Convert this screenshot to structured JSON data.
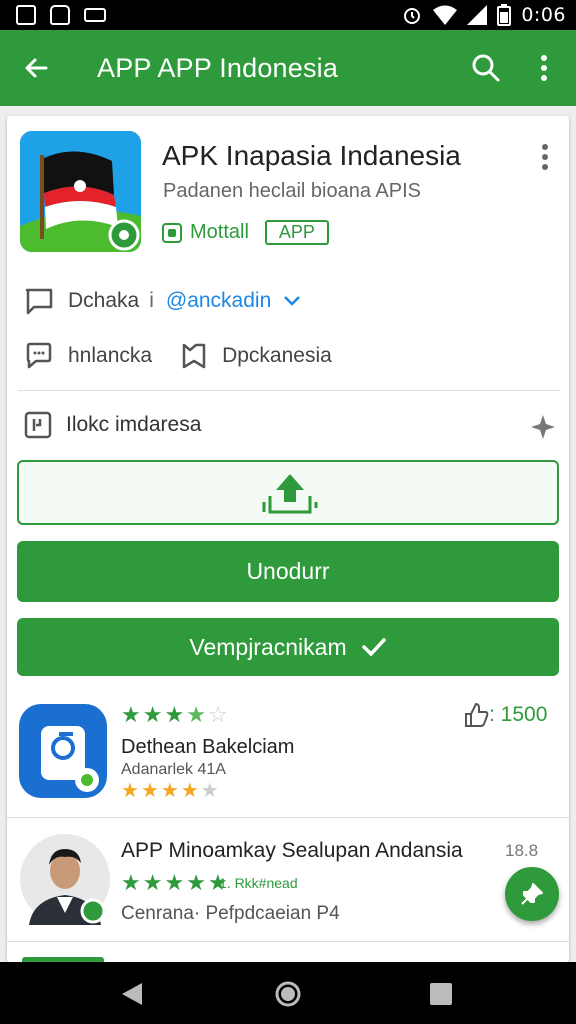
{
  "status_bar": {
    "time": "0:06",
    "icons": [
      "notification-icon",
      "android-icon",
      "screen-icon",
      "alarm-icon",
      "wifi-icon",
      "signal-icon",
      "battery-icon"
    ]
  },
  "app_bar": {
    "title": "APP  APP Indonesia",
    "icons": [
      "back-arrow-icon",
      "search-icon",
      "more-vert-icon"
    ]
  },
  "app_header": {
    "name": "APK Inapasia Indanesia",
    "subtitle": "Padanen heclail bioana APIS",
    "badge_label": "Mottall",
    "badge_pill": "APP"
  },
  "info": {
    "row1_left": "Dchaka",
    "row1_sep": "i",
    "row1_link": "@anckadin",
    "row2_left": "hnlancka",
    "row2_right": "Dpckanesia",
    "section_label": "Ilokc imdaresa"
  },
  "buttons": {
    "primary_label": "Unodurr",
    "secondary_label": "Vempjracnikam"
  },
  "list": [
    {
      "title": "Dethean Bakelciam",
      "subtitle": "Adanarlek 41A",
      "likes": ": 1500",
      "top_rating": 4,
      "bottom_rating": 4
    },
    {
      "title": "APP Minoamkay Sealupan Andansia",
      "subtitle": "Cenrana· Pefpdcaeian  P4",
      "count": "18.8",
      "extra": "1.  Rkk#nead",
      "rating": 5
    }
  ],
  "colors": {
    "primary": "#2e9a3c",
    "link": "#1e88e5",
    "star_filled": "#2e9a3c",
    "star_orange": "#f5a623"
  }
}
